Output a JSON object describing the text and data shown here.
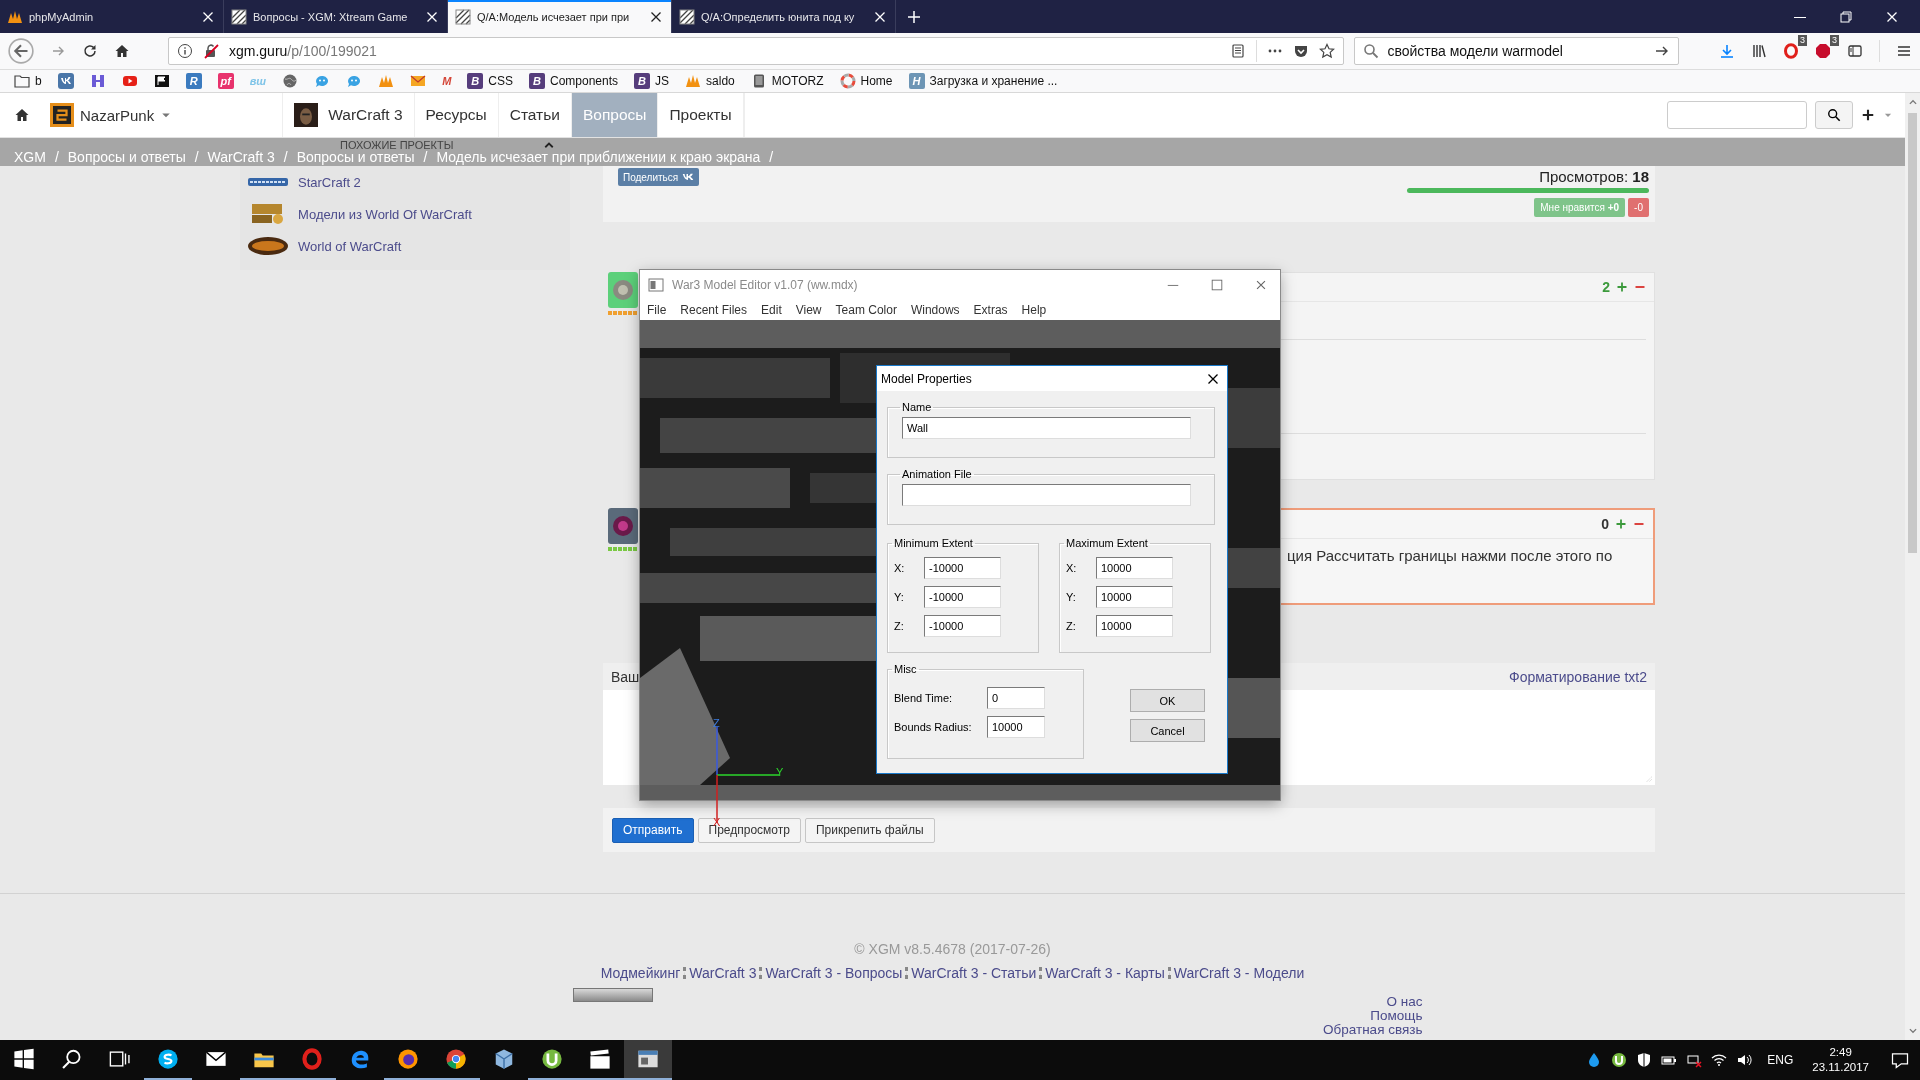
{
  "browser": {
    "tabs": [
      {
        "title": "phpMyAdmin",
        "kind": "pma",
        "selected": false
      },
      {
        "title": "Вопросы - XGM: Xtream Game",
        "kind": "hatch",
        "selected": false
      },
      {
        "title": "Q/A:Модель исчезает при при",
        "kind": "hatch",
        "selected": true
      },
      {
        "title": "Q/A:Определить юнита под ку",
        "kind": "hatch",
        "selected": false
      }
    ],
    "url": {
      "host": "xgm.guru",
      "path": "/p/100/199021"
    },
    "search": {
      "value": "свойства модели warmodel"
    },
    "badges": [
      {
        "kind": "opera",
        "count": "3"
      },
      {
        "kind": "adblock",
        "count": "3"
      }
    ],
    "bookmarks": [
      {
        "kind": "folder",
        "label": "b"
      },
      {
        "kind": "vk"
      },
      {
        "kind": "hlogo"
      },
      {
        "kind": "youtube"
      },
      {
        "kind": "flag"
      },
      {
        "kind": "tile",
        "glyph": "R",
        "color": "#3b7bbf"
      },
      {
        "kind": "tile",
        "glyph": "pf",
        "color": "#e8336d"
      },
      {
        "kind": "glyph",
        "glyph": "вш",
        "color": "#7fc4e8"
      },
      {
        "kind": "globe"
      },
      {
        "kind": "bubble"
      },
      {
        "kind": "bubble"
      },
      {
        "kind": "pma"
      },
      {
        "kind": "mail"
      },
      {
        "kind": "glyph",
        "glyph": "M",
        "color": "#d44638"
      },
      {
        "kind": "tile",
        "glyph": "B",
        "color": "#563d7c",
        "label": "CSS"
      },
      {
        "kind": "tile",
        "glyph": "B",
        "color": "#563d7c",
        "label": "Components"
      },
      {
        "kind": "tile",
        "glyph": "B",
        "color": "#563d7c",
        "label": "JS"
      },
      {
        "kind": "pma",
        "label": "saldo"
      },
      {
        "kind": "box",
        "label": "MOTORZ"
      },
      {
        "kind": "ring",
        "label": "Home"
      },
      {
        "kind": "tile",
        "glyph": "H",
        "color": "#6d95b5",
        "label": "Загрузка и хранение ..."
      }
    ]
  },
  "site": {
    "user": "NazarPunk",
    "nav": [
      {
        "label": "WarCraft 3",
        "kind": "game",
        "selected": false
      },
      {
        "label": "Ресурсы",
        "selected": false
      },
      {
        "label": "Статьи",
        "selected": false
      },
      {
        "label": "Вопросы",
        "selected": true
      },
      {
        "label": "Проекты",
        "selected": false
      }
    ],
    "breadcrumbs": [
      {
        "label": "XGM",
        "sep": "/"
      },
      {
        "label": "Вопросы и ответы",
        "sep": "/"
      },
      {
        "label": "WarCraft 3",
        "sep": "/"
      },
      {
        "label": "Вопросы и ответы",
        "sep": "/"
      },
      {
        "label": "Модель исчезает при приближении к краю экрана",
        "sep": "/"
      }
    ],
    "similar": {
      "title": "ПОХОЖИЕ ПРОЕКТЫ",
      "expanded": true,
      "items": [
        {
          "label": "StarCraft 2",
          "kind": "sc"
        },
        {
          "label": "Модели из World Of WarCraft",
          "kind": "models"
        },
        {
          "label": "World of WarCraft",
          "kind": "wow"
        }
      ]
    }
  },
  "question": {
    "share": "Поделиться",
    "views": "Просмотров: **18**",
    "like": "Мне нравится **+0**",
    "dislike": "-0"
  },
  "answers": [
    {
      "score": "2",
      "highlighted": false,
      "color": "#f0a030"
    },
    {
      "score": "0",
      "highlighted": true,
      "color": "#7ac943",
      "text": "ция Рассчитать границы нажми после этого по"
    }
  ],
  "reply": {
    "title": "Ваш",
    "formatting": "Форматирование txt2"
  },
  "actions": [
    {
      "label": "Отправить",
      "primary": true
    },
    {
      "label": "Предпросмотр",
      "primary": false
    },
    {
      "label": "Прикрепить файлы",
      "primary": false
    }
  ],
  "footer": {
    "copyright": "© XGM v8.5.4678 (2017-07-26)",
    "links": [
      "Модмейкинг",
      "WarCraft 3",
      "WarCraft 3 - Вопросы",
      "WarCraft 3 - Статьи",
      "WarCraft 3 - Карты",
      "WarCraft 3 - Модели"
    ],
    "side_links": [
      "О нас",
      "Помощь",
      "Обратная связь"
    ]
  },
  "editor": {
    "title": "War3 Model Editor v1.07 (ww.mdx)",
    "menu": [
      "File",
      "Recent Files",
      "Edit",
      "View",
      "Team Color",
      "Windows",
      "Extras",
      "Help"
    ],
    "axes": [
      {
        "label": "Z",
        "kind": "z"
      },
      {
        "label": "Y",
        "kind": "y"
      },
      {
        "label": "X",
        "kind": "x"
      }
    ],
    "dialog": {
      "title": "Model Properties",
      "name": {
        "label": "Name",
        "value": "Wall"
      },
      "animation": {
        "label": "Animation File"
      },
      "extents": [
        {
          "label": "Minimum Extent",
          "fields": [
            {
              "label": "X:",
              "value": "-10000"
            },
            {
              "label": "Y:",
              "value": "-10000"
            },
            {
              "label": "Z:",
              "value": "-10000"
            }
          ]
        },
        {
          "label": "Maximum Extent",
          "fields": [
            {
              "label": "X:",
              "value": "10000"
            },
            {
              "label": "Y:",
              "value": "10000"
            },
            {
              "label": "Z:",
              "value": "10000"
            }
          ]
        }
      ],
      "misc": {
        "label": "Misc",
        "fields": [
          {
            "label": "Blend Time:",
            "value": "0"
          },
          {
            "label": "Bounds Radius:",
            "value": "10000"
          }
        ]
      },
      "buttons": [
        "OK",
        "Cancel"
      ]
    }
  },
  "taskbar": {
    "apps": [
      {
        "kind": "start",
        "running": false,
        "selected": false
      },
      {
        "kind": "tsearch",
        "running": false,
        "selected": false
      },
      {
        "kind": "taskview",
        "running": false,
        "selected": false
      },
      {
        "kind": "skype",
        "running": true,
        "selected": false
      },
      {
        "kind": "envelope",
        "running": false,
        "selected": false
      },
      {
        "kind": "explorer",
        "running": true,
        "selected": false
      },
      {
        "kind": "opera",
        "running": true,
        "selected": false
      },
      {
        "kind": "edge",
        "running": false,
        "selected": false
      },
      {
        "kind": "firefox",
        "running": true,
        "selected": false
      },
      {
        "kind": "chrome",
        "running": true,
        "selected": false
      },
      {
        "kind": "cube",
        "running": false,
        "selected": false
      },
      {
        "kind": "utorrent",
        "running": true,
        "selected": false
      },
      {
        "kind": "clapper",
        "running": true,
        "selected": false
      },
      {
        "kind": "editorapp",
        "running": true,
        "selected": true
      }
    ],
    "tray": [
      {
        "kind": "traydrop"
      },
      {
        "kind": "utorrent"
      },
      {
        "kind": "shield"
      },
      {
        "kind": "battery"
      },
      {
        "kind": "netx"
      },
      {
        "kind": "wifi"
      },
      {
        "kind": "volume"
      }
    ],
    "lang": "ENG",
    "time": "2:49",
    "date": "23.11.2017"
  }
}
